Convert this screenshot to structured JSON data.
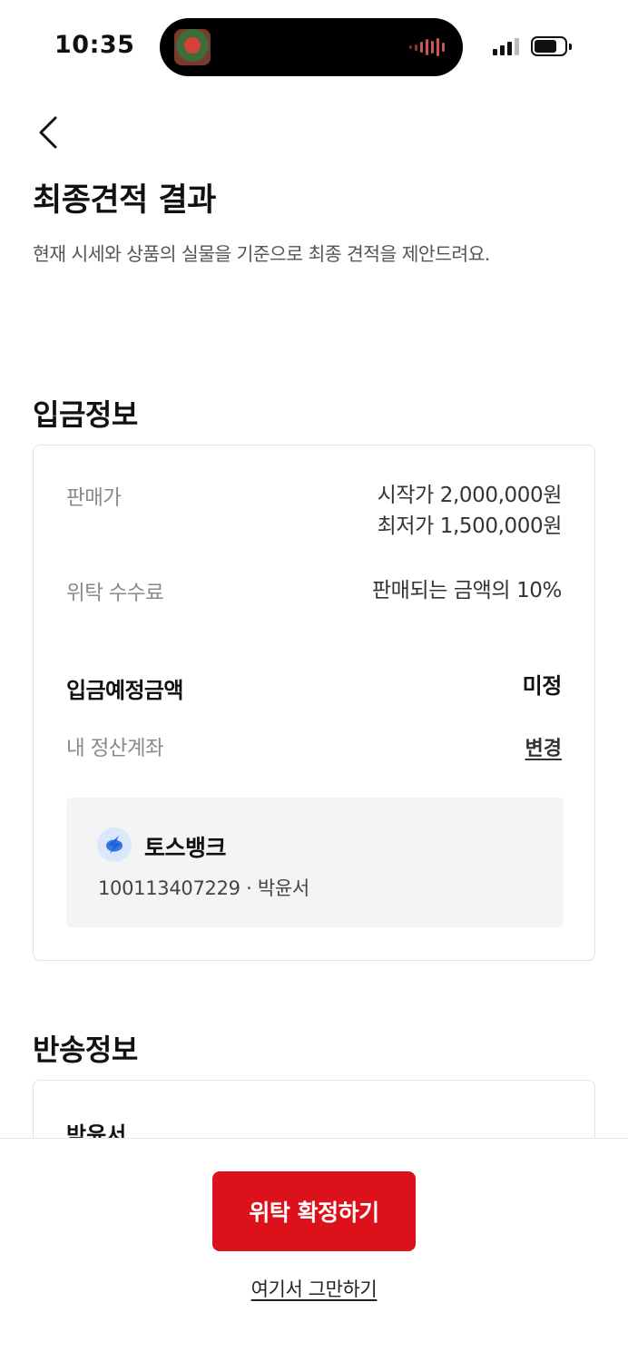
{
  "status_bar": {
    "time": "10:35"
  },
  "header": {
    "title": "최종견적 결과",
    "subtitle": "현재 시세와 상품의 실물을 기준으로 최종 견적을 제안드려요."
  },
  "deposit": {
    "section_title": "입금정보",
    "price_label": "판매가",
    "price_start": "시작가 2,000,000원",
    "price_min": "최저가 1,500,000원",
    "fee_label": "위탁 수수료",
    "fee_value": "판매되는 금액의 10%",
    "expected_label": "입금예정금액",
    "expected_value": "미정",
    "account_label": "내 정산계좌",
    "change_label": "변경",
    "bank_name": "토스뱅크",
    "account_info": "100113407229 · 박윤서"
  },
  "shipping": {
    "section_title": "반송정보",
    "name": "박윤서"
  },
  "footer": {
    "confirm_label": "위탁 확정하기",
    "stop_label": "여기서 그만하기"
  },
  "colors": {
    "accent": "#DC111B",
    "bank_blue": "#1B64DA"
  }
}
